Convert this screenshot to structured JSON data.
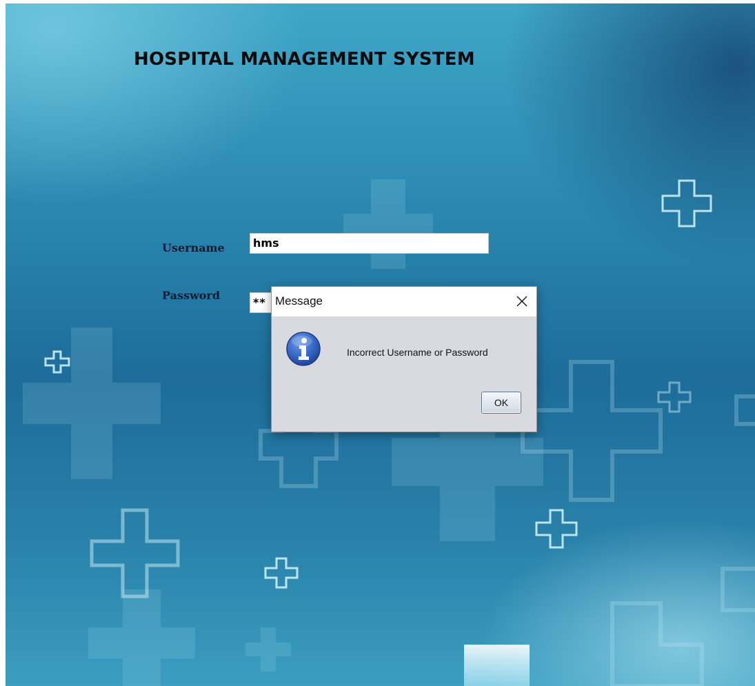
{
  "app": {
    "title": "HOSPITAL MANAGEMENT SYSTEM"
  },
  "login": {
    "username_label": "Username",
    "username_value": "hms",
    "password_label": "Password",
    "password_value": "**"
  },
  "dialog": {
    "title": "Message",
    "message": "Incorrect Username or Password",
    "ok_label": "OK",
    "close_glyph": "×",
    "icon": "info-icon",
    "icon_color": "#2f5fbf"
  },
  "colors": {
    "background_primary": "#1d6c99",
    "background_light": "#3fa6c7"
  }
}
